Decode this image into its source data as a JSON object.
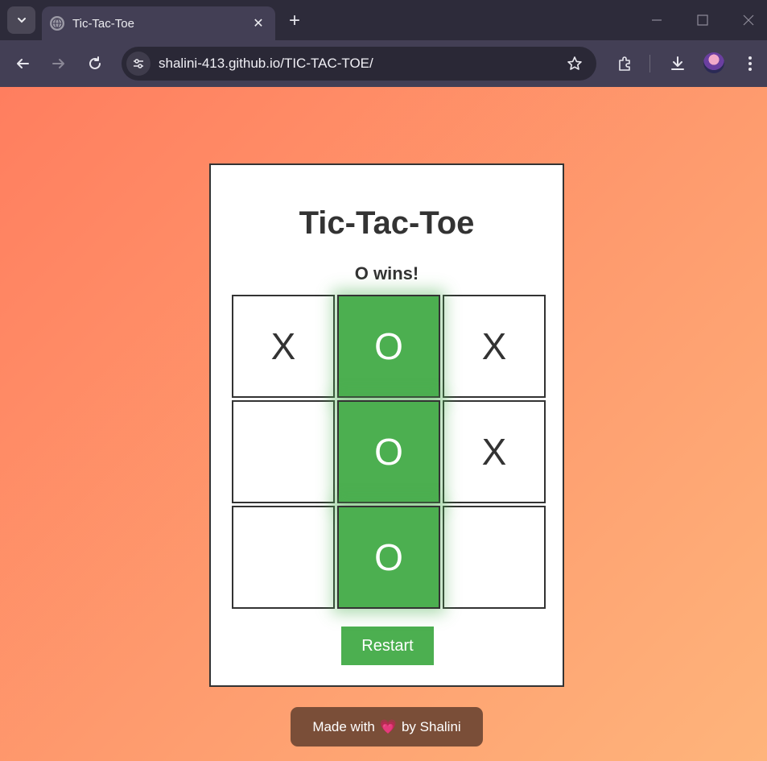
{
  "browser": {
    "tab_title": "Tic-Tac-Toe",
    "url": "shalini-413.github.io/TIC-TAC-TOE/"
  },
  "game": {
    "title": "Tic-Tac-Toe",
    "status": "O wins!",
    "cells": [
      "X",
      "O",
      "X",
      "",
      "O",
      "X",
      "",
      "O",
      ""
    ],
    "winning_cells": [
      1,
      4,
      7
    ],
    "restart_label": "Restart",
    "win_color": "#4caf50"
  },
  "footer": {
    "made_with": "Made with",
    "heart": "💗",
    "by": "by Shalini"
  },
  "theme": {
    "gradient_start": "#ff7e5f",
    "gradient_end": "#feb47b",
    "footer_bg": "#7a4e38"
  }
}
